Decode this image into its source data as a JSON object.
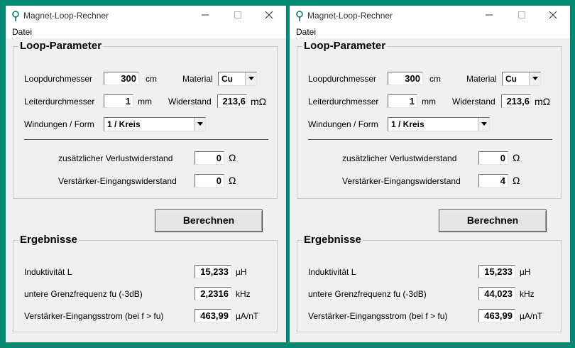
{
  "windows": {
    "left": {
      "title": "Magnet-Loop-Rechner",
      "menu": {
        "file": "Datei"
      },
      "params": {
        "group_title": "Loop-Parameter",
        "diameter_label": "Loopdurchmesser",
        "diameter_value": "300",
        "diameter_unit": "cm",
        "material_label": "Material",
        "material_value": "Cu",
        "conductor_label": "Leiterdurchmesser",
        "conductor_value": "1",
        "conductor_unit": "mm",
        "resistance_label": "Widerstand",
        "resistance_value": "213,6",
        "resistance_unit": "mΩ",
        "turns_label": "Windungen / Form",
        "turns_value": "1 / Kreis",
        "extra_loss_label": "zusätzlicher Verlustwiderstand",
        "extra_loss_value": "0",
        "extra_loss_unit": "Ω",
        "amp_input_label": "Verstärker-Eingangswiderstand",
        "amp_input_value": "0",
        "amp_input_unit": "Ω"
      },
      "calculate_label": "Berechnen",
      "results": {
        "group_title": "Ergebnisse",
        "inductance_label": "Induktivität  L",
        "inductance_value": "15,233",
        "inductance_unit": "µH",
        "cutoff_label": "untere Grenzfrequenz  fu (-3dB)",
        "cutoff_value": "2,2316",
        "cutoff_unit": "kHz",
        "current_label": "Verstärker-Eingangsstrom  (bei f > fu)",
        "current_value": "463,99",
        "current_unit": "µA/nT"
      }
    },
    "right": {
      "title": "Magnet-Loop-Rechner",
      "menu": {
        "file": "Datei"
      },
      "params": {
        "group_title": "Loop-Parameter",
        "diameter_label": "Loopdurchmesser",
        "diameter_value": "300",
        "diameter_unit": "cm",
        "material_label": "Material",
        "material_value": "Cu",
        "conductor_label": "Leiterdurchmesser",
        "conductor_value": "1",
        "conductor_unit": "mm",
        "resistance_label": "Widerstand",
        "resistance_value": "213,6",
        "resistance_unit": "mΩ",
        "turns_label": "Windungen / Form",
        "turns_value": "1 / Kreis",
        "extra_loss_label": "zusätzlicher Verlustwiderstand",
        "extra_loss_value": "0",
        "extra_loss_unit": "Ω",
        "amp_input_label": "Verstärker-Eingangswiderstand",
        "amp_input_value": "4",
        "amp_input_unit": "Ω"
      },
      "calculate_label": "Berechnen",
      "results": {
        "group_title": "Ergebnisse",
        "inductance_label": "Induktivität  L",
        "inductance_value": "15,233",
        "inductance_unit": "µH",
        "cutoff_label": "untere Grenzfrequenz  fu (-3dB)",
        "cutoff_value": "44,023",
        "cutoff_unit": "kHz",
        "current_label": "Verstärker-Eingangsstrom  (bei f > fu)",
        "current_value": "463,99",
        "current_unit": "µA/nT"
      }
    }
  },
  "colors": {
    "desktop": "#008a72",
    "window_bg": "#f0f0f0",
    "titlebar_bg": "#ffffff",
    "app_icon": "#0b7a6e"
  }
}
